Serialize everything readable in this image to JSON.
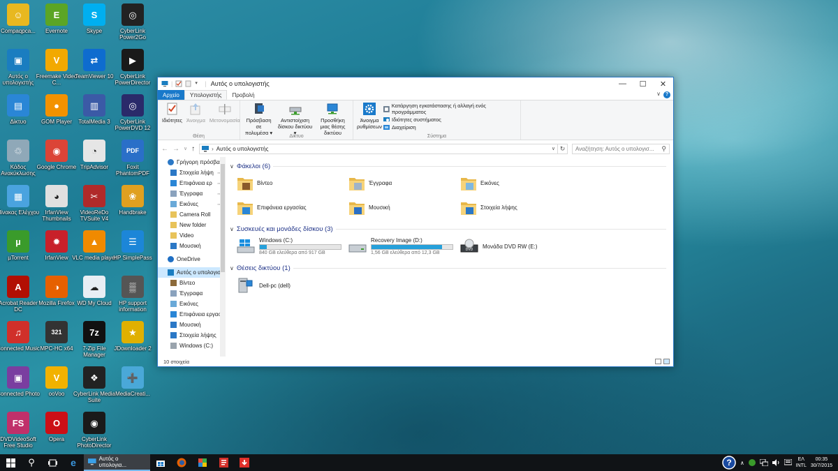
{
  "desktop": {
    "icons": [
      {
        "label": "Compaqpca...",
        "color": "#e8b820",
        "glyph": "☺",
        "icon": "user-folder-icon"
      },
      {
        "label": "Evernote",
        "color": "#5ba525",
        "glyph": "E",
        "icon": "evernote-icon"
      },
      {
        "label": "Skype",
        "color": "#00aff0",
        "glyph": "S",
        "icon": "skype-icon"
      },
      {
        "label": "CyberLink Power2Go",
        "color": "#222222",
        "glyph": "◎",
        "icon": "power2go-icon"
      },
      {
        "label": "Αυτός ο υπολογιστής",
        "color": "#1a7dc0",
        "glyph": "▣",
        "icon": "this-pc-icon"
      },
      {
        "label": "Freemake Video C...",
        "color": "#f2a900",
        "glyph": "V",
        "icon": "freemake-icon"
      },
      {
        "label": "TeamViewer 10",
        "color": "#0e6ccf",
        "glyph": "⇄",
        "icon": "teamviewer-icon"
      },
      {
        "label": "CyberLink PowerDirector",
        "color": "#1a1a1a",
        "glyph": "▶",
        "icon": "powerdirector-icon"
      },
      {
        "label": "Δίκτυο",
        "color": "#2a86d6",
        "glyph": "▤",
        "icon": "network-icon"
      },
      {
        "label": "GOM Player",
        "color": "#f39200",
        "glyph": "●",
        "icon": "gom-player-icon"
      },
      {
        "label": "TotalMedia 3",
        "color": "#3b5aa6",
        "glyph": "▥",
        "icon": "totalmedia-icon"
      },
      {
        "label": "CyberLink PowerDVD 12",
        "color": "#2a2a6a",
        "glyph": "◎",
        "icon": "powerdvd-icon"
      },
      {
        "label": "Κάδος Ανακύκλωσης",
        "color": "#8fa8b8",
        "glyph": "♲",
        "icon": "recycle-bin-icon"
      },
      {
        "label": "Google Chrome",
        "color": "#db4437",
        "glyph": "◉",
        "icon": "chrome-icon"
      },
      {
        "label": "TripAdvisor",
        "color": "#e6e6e6",
        "glyph": "◔",
        "icon": "tripadvisor-icon"
      },
      {
        "label": "Foxit PhantomPDF",
        "color": "#2a6fc8",
        "glyph": "PDF",
        "icon": "foxit-icon"
      },
      {
        "label": "Πίνακας Ελέγχου",
        "color": "#4aa3df",
        "glyph": "▦",
        "icon": "control-panel-icon"
      },
      {
        "label": "IrfanView Thumbnails",
        "color": "#e0e0e0",
        "glyph": "◕",
        "icon": "irfanview-thumbnails-icon"
      },
      {
        "label": "VideoReDo TVSuite V4",
        "color": "#b02a2a",
        "glyph": "✂",
        "icon": "videoredo-icon"
      },
      {
        "label": "Handbrake",
        "color": "#e0a020",
        "glyph": "❀",
        "icon": "handbrake-icon"
      },
      {
        "label": "µTorrent",
        "color": "#3a9b2b",
        "glyph": "µ",
        "icon": "utorrent-icon"
      },
      {
        "label": "IrfanView",
        "color": "#c8202a",
        "glyph": "✹",
        "icon": "irfanview-icon"
      },
      {
        "label": "VLC media player",
        "color": "#f08a00",
        "glyph": "▲",
        "icon": "vlc-icon"
      },
      {
        "label": "HP SimplePass",
        "color": "#1c86d8",
        "glyph": "☰",
        "icon": "hp-simplepass-icon"
      },
      {
        "label": "Acrobat Reader DC",
        "color": "#b20f03",
        "glyph": "A",
        "icon": "acrobat-icon"
      },
      {
        "label": "Mozilla Firefox",
        "color": "#e66000",
        "glyph": "◑",
        "icon": "firefox-icon"
      },
      {
        "label": "WD My Cloud",
        "color": "#e8eef4",
        "glyph": "☁",
        "icon": "wd-cloud-icon"
      },
      {
        "label": "HP support information",
        "color": "#555555",
        "glyph": "▒",
        "icon": "hp-support-icon"
      },
      {
        "label": "Connected Music",
        "color": "#d0302a",
        "glyph": "♫",
        "icon": "connected-music-icon"
      },
      {
        "label": "MPC-HC x64",
        "color": "#333333",
        "glyph": "321",
        "icon": "mpc-hc-icon"
      },
      {
        "label": "7-Zip File Manager",
        "color": "#111111",
        "glyph": "7z",
        "icon": "7zip-icon"
      },
      {
        "label": "JDownloader 2",
        "color": "#e0b000",
        "glyph": "★",
        "icon": "jdownloader-icon"
      },
      {
        "label": "Connected Photo",
        "color": "#7a3ea0",
        "glyph": "▣",
        "icon": "connected-photo-icon"
      },
      {
        "label": "ooVoo",
        "color": "#f2b200",
        "glyph": "V",
        "icon": "oovoo-icon"
      },
      {
        "label": "CyberLink Media Suite",
        "color": "#222222",
        "glyph": "❖",
        "icon": "media-suite-icon"
      },
      {
        "label": "MediaCreati...",
        "color": "#4aa8d8",
        "glyph": "➕",
        "icon": "media-creation-icon"
      },
      {
        "label": "DVDVideoSoft Free Studio",
        "color": "#c0306a",
        "glyph": "FS",
        "icon": "free-studio-icon"
      },
      {
        "label": "Opera",
        "color": "#cc0f16",
        "glyph": "O",
        "icon": "opera-icon"
      },
      {
        "label": "CyberLink PhotoDirector",
        "color": "#1a1a1a",
        "glyph": "◉",
        "icon": "photodirector-icon"
      }
    ]
  },
  "window": {
    "title": "Αυτός ο υπολογιστής",
    "controls": {
      "minimize": "—",
      "maximize": "☐",
      "close": "✕"
    },
    "tabs": [
      "Αρχείο",
      "Υπολογιστής",
      "Προβολή"
    ],
    "ribbon": {
      "location": {
        "name": "Θέση",
        "buttons": [
          "Ιδιότητες",
          "Άνοιγμα",
          "Μετονομασία"
        ]
      },
      "network": {
        "name": "Δίκτυο",
        "buttons": [
          "Πρόσβαση σε πολυμέσα ▾",
          "Αντιστοίχιση δίσκου δικτύου ▾",
          "Προσθήκη μιας θέσης δικτύου"
        ]
      },
      "system": {
        "name": "Σύστημα",
        "big": "Άνοιγμα ρυθμίσεων",
        "small": [
          "Κατάργηση εγκατάστασης ή αλλαγή ενός προγράμματος",
          "Ιδιότητες συστήματος",
          "Διαχείριση"
        ]
      }
    },
    "address": "Αυτός ο υπολογιστής",
    "search_placeholder": "Αναζήτηση: Αυτός ο υπολογισ...",
    "nav": [
      {
        "label": "Γρήγορη πρόσβα",
        "level": 0,
        "icon": "star-icon",
        "color": "#2b78c6",
        "pin": false
      },
      {
        "label": "Στοιχεία λήψη",
        "level": 1,
        "icon": "download-icon",
        "color": "#2b78c6",
        "pin": true
      },
      {
        "label": "Επιφάνεια ερ",
        "level": 1,
        "icon": "desktop-icon",
        "color": "#2a86d6",
        "pin": true
      },
      {
        "label": "Έγγραφα",
        "level": 1,
        "icon": "documents-icon",
        "color": "#8aa2bd",
        "pin": true
      },
      {
        "label": "Εικόνες",
        "level": 1,
        "icon": "pictures-icon",
        "color": "#6aa9d8",
        "pin": true
      },
      {
        "label": "Camera Roll",
        "level": 1,
        "icon": "folder-icon",
        "color": "#e8c35a",
        "pin": false
      },
      {
        "label": "New folder",
        "level": 1,
        "icon": "folder-icon",
        "color": "#e8c35a",
        "pin": false
      },
      {
        "label": "Video",
        "level": 1,
        "icon": "folder-icon",
        "color": "#e8c35a",
        "pin": false
      },
      {
        "label": "Μουσική",
        "level": 1,
        "icon": "music-icon",
        "color": "#2b78c6",
        "pin": false
      },
      {
        "label": "OneDrive",
        "level": 0,
        "icon": "onedrive-icon",
        "color": "#1f6fc4",
        "pin": false
      },
      {
        "label": "Αυτός ο υπολογισ",
        "level": 0,
        "icon": "this-pc-icon",
        "color": "#1a7dc0",
        "pin": false,
        "selected": true
      },
      {
        "label": "Βίντεο",
        "level": 1,
        "icon": "videos-icon",
        "color": "#8c6a3a",
        "pin": false
      },
      {
        "label": "Έγγραφα",
        "level": 1,
        "icon": "documents-icon",
        "color": "#8aa2bd",
        "pin": false
      },
      {
        "label": "Εικόνες",
        "level": 1,
        "icon": "pictures-icon",
        "color": "#6aa9d8",
        "pin": false
      },
      {
        "label": "Επιφάνεια εργασ",
        "level": 1,
        "icon": "desktop-icon",
        "color": "#2a86d6",
        "pin": false
      },
      {
        "label": "Μουσική",
        "level": 1,
        "icon": "music-icon",
        "color": "#2b78c6",
        "pin": false
      },
      {
        "label": "Στοιχεία λήψης",
        "level": 1,
        "icon": "download-icon",
        "color": "#2b78c6",
        "pin": false
      },
      {
        "label": "Windows (C:)",
        "level": 1,
        "icon": "drive-icon",
        "color": "#9aa4ad",
        "pin": false
      }
    ],
    "groups": {
      "folders": {
        "title": "Φάκελοι (6)",
        "items": [
          {
            "label": "Βίντεο",
            "icon": "videos-folder-icon",
            "badge": "#8a5a2a"
          },
          {
            "label": "Έγγραφα",
            "icon": "documents-folder-icon",
            "badge": "#9fb3c8"
          },
          {
            "label": "Εικόνες",
            "icon": "pictures-folder-icon",
            "badge": "#7fb8e0"
          },
          {
            "label": "Επιφάνεια εργασίας",
            "icon": "desktop-folder-icon",
            "badge": "#2a86d6"
          },
          {
            "label": "Μουσική",
            "icon": "music-folder-icon",
            "badge": "#2b6fc4"
          },
          {
            "label": "Στοιχεία λήψης",
            "icon": "downloads-folder-icon",
            "badge": "#2b78c6"
          }
        ]
      },
      "drives": {
        "title": "Συσκευές και μονάδες δίσκου (3)",
        "items": [
          {
            "label": "Windows (C:)",
            "sub": "840 GB ελεύθερα από 917 GB",
            "used": 0.084,
            "icon": "windows-drive-icon"
          },
          {
            "label": "Recovery Image (D:)",
            "sub": "1,56 GB ελεύθερα από 12,3 GB",
            "used": 0.873,
            "icon": "hdd-icon"
          },
          {
            "label": "Μονάδα DVD RW (E:)",
            "sub": "",
            "used": null,
            "icon": "dvd-drive-icon"
          }
        ]
      },
      "network": {
        "title": "Θέσεις δικτύου (1)",
        "items": [
          {
            "label": "Dell-pc (dell)",
            "icon": "network-location-icon"
          }
        ]
      }
    },
    "status": "10 στοιχεία"
  },
  "taskbar": {
    "active_app": "Αυτός ο υπολογια...",
    "lang": "ΕΛ",
    "lang2": "INTL",
    "time": "00:35",
    "date": "30/7/2015"
  }
}
